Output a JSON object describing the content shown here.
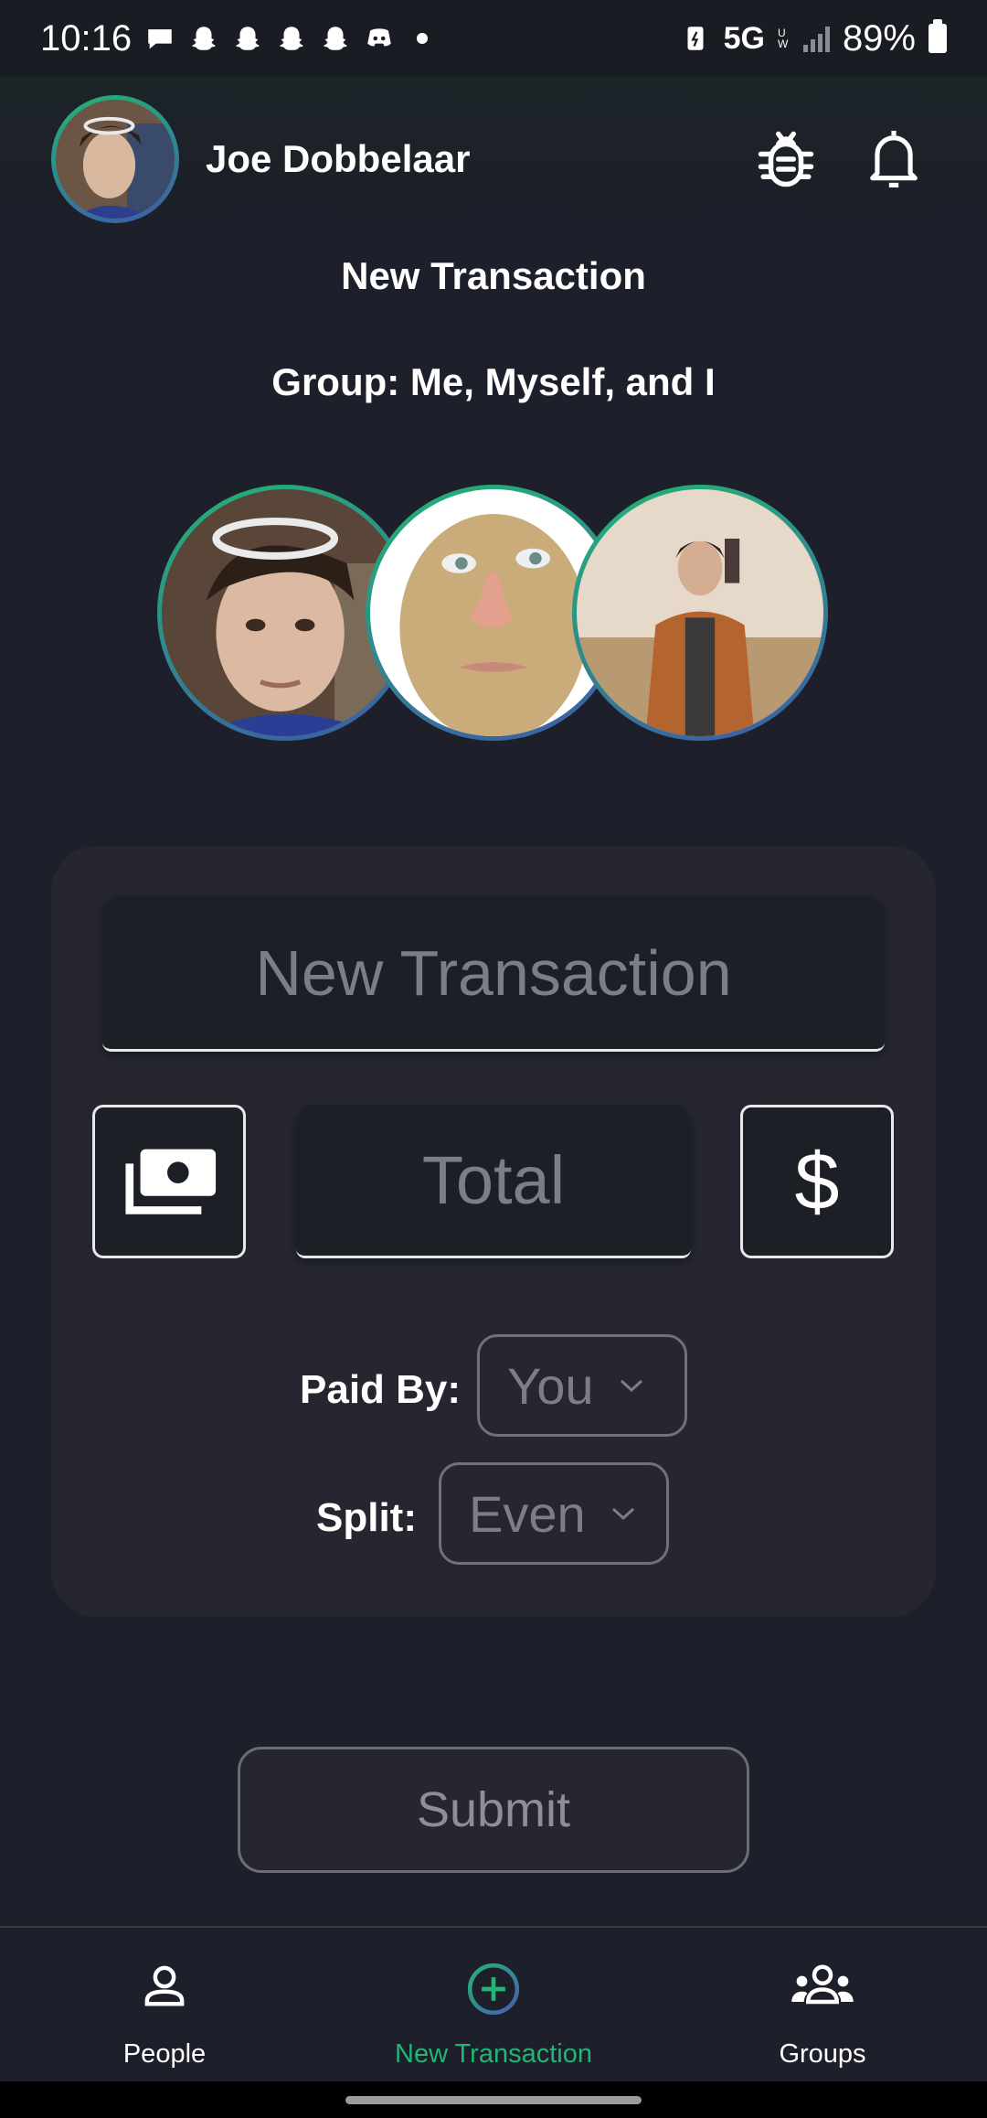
{
  "status_bar": {
    "time": "10:16",
    "network": "5G",
    "network_sub": "UW",
    "battery": "89%",
    "icons": [
      "message-icon",
      "snapchat-icon",
      "snapchat-icon",
      "snapchat-icon",
      "snapchat-icon",
      "discord-icon",
      "dot-icon"
    ]
  },
  "header": {
    "user_name": "Joe Dobbelaar",
    "icons": [
      "bug-icon",
      "bell-icon"
    ]
  },
  "page": {
    "title": "New Transaction",
    "group_label": "Group: Me, Myself, and I"
  },
  "form": {
    "name_placeholder": "New Transaction",
    "total_placeholder": "Total",
    "currency_symbol": "$",
    "paid_by_label": "Paid By:",
    "paid_by_value": "You",
    "split_label": "Split:",
    "split_value": "Even",
    "submit_label": "Submit"
  },
  "bottom_nav": {
    "items": [
      {
        "label": "People",
        "icon": "person-icon",
        "active": false
      },
      {
        "label": "New Transaction",
        "icon": "plus-circle-icon",
        "active": true
      },
      {
        "label": "Groups",
        "icon": "groups-icon",
        "active": false
      }
    ]
  },
  "colors": {
    "background": "#1d1f2a",
    "card": "#25262f",
    "accent": "#22b573",
    "ring_gradient_end": "#3e5aa8"
  }
}
